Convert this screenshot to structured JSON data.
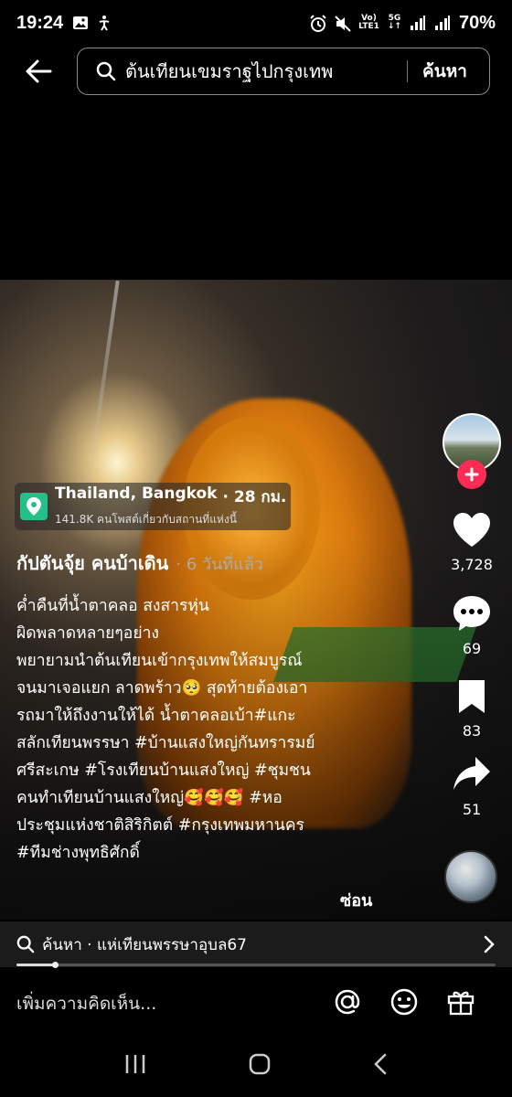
{
  "status_bar": {
    "time": "19:24",
    "network_volte": "Vo)",
    "network_lte": "LTE1",
    "network_5g": "5G",
    "battery": "70%"
  },
  "search": {
    "query": "ต้นเทียนเขมราฐไปกรุงเทพ",
    "button_label": "ค้นหา"
  },
  "location": {
    "place": "Thailand, Bangkok",
    "distance": "· 28 กม.",
    "posts": "141.8K คนโพสต์เกี่ยวกับสถานที่แห่งนี้"
  },
  "post": {
    "author": "กัปตันจุ้ย คนบ้าเดิน",
    "time_ago": "· 6 วันที่แล้ว",
    "caption_lines": [
      "ค่ำคืนที่น้ำตาคลอ  สงสารหุ่น",
      "ผิดพลาดหลายๆอย่าง",
      "พยายามนำต้นเทียนเข้ากรุงเทพให้สมบูรณ์",
      "จนมาเจอแยก ลาดพร้าว🥺 สุดท้ายต้องเอา",
      "รถมาให้ถึงงานให้ได้   น้ำตาคลอเบ้า#แกะ",
      "สลักเทียนพรรษา #บ้านแสงใหญ่กันทรารมย์",
      "ศรีสะเกษ #โรงเทียนบ้านแสงใหญ่ #ชุมชน",
      "คนทำเทียนบ้านแสงใหญ่🥰🥰🥰 #หอ",
      "ประชุมแห่งชาติสิริกิตต์ #กรุงเทพมหานคร",
      "#ทีมช่างพุทธิศักดิ์"
    ],
    "hide_label": "ซ่อน"
  },
  "actions": {
    "likes": "3,728",
    "comments": "69",
    "saves": "83",
    "shares": "51"
  },
  "related_search": {
    "label": "ค้นหา · แห่เทียนพรรษาอุบล67"
  },
  "playback": {
    "progress_fraction": 0.08
  },
  "comment": {
    "placeholder": "เพิ่มความคิดเห็น..."
  },
  "colors": {
    "follow_accent": "#fe2c55",
    "location_pin": "#25c08a"
  }
}
